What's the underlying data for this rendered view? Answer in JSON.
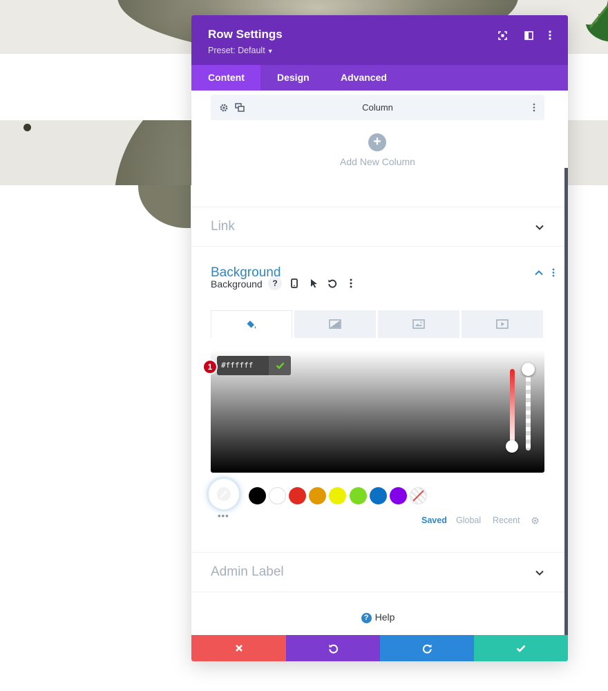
{
  "modal": {
    "title": "Row Settings",
    "preset": "Preset: Default"
  },
  "tabs": [
    {
      "label": "Content"
    },
    {
      "label": "Design"
    },
    {
      "label": "Advanced"
    }
  ],
  "content": {
    "column_label": "Column",
    "add_column_label": "Add New Column",
    "sections": {
      "link": "Link",
      "background": "Background",
      "admin_label": "Admin Label"
    },
    "background_field_label": "Background",
    "help_label": "Help"
  },
  "color_picker": {
    "hex_value": "#ffffff",
    "badge_number": "1",
    "hue_color": "#e42828",
    "palette_swatches": [
      "#000000",
      "#ffffff",
      "#e02b20",
      "#e09900",
      "#edf000",
      "#7cda24",
      "#0c71c3",
      "#8300e9",
      "transparent"
    ],
    "palette_tabs": [
      "Saved",
      "Global",
      "Recent"
    ],
    "active_palette_tab": "Saved"
  },
  "colors": {
    "header": "#6c2eb9",
    "tabs_bar": "#7e3bd0",
    "active_tab": "#8f42ec",
    "accent_blue": "#2e86c6",
    "footer_cancel": "#ef5555",
    "footer_undo": "#7d3bcf",
    "footer_redo": "#2b87da",
    "footer_save": "#29c4a9"
  }
}
